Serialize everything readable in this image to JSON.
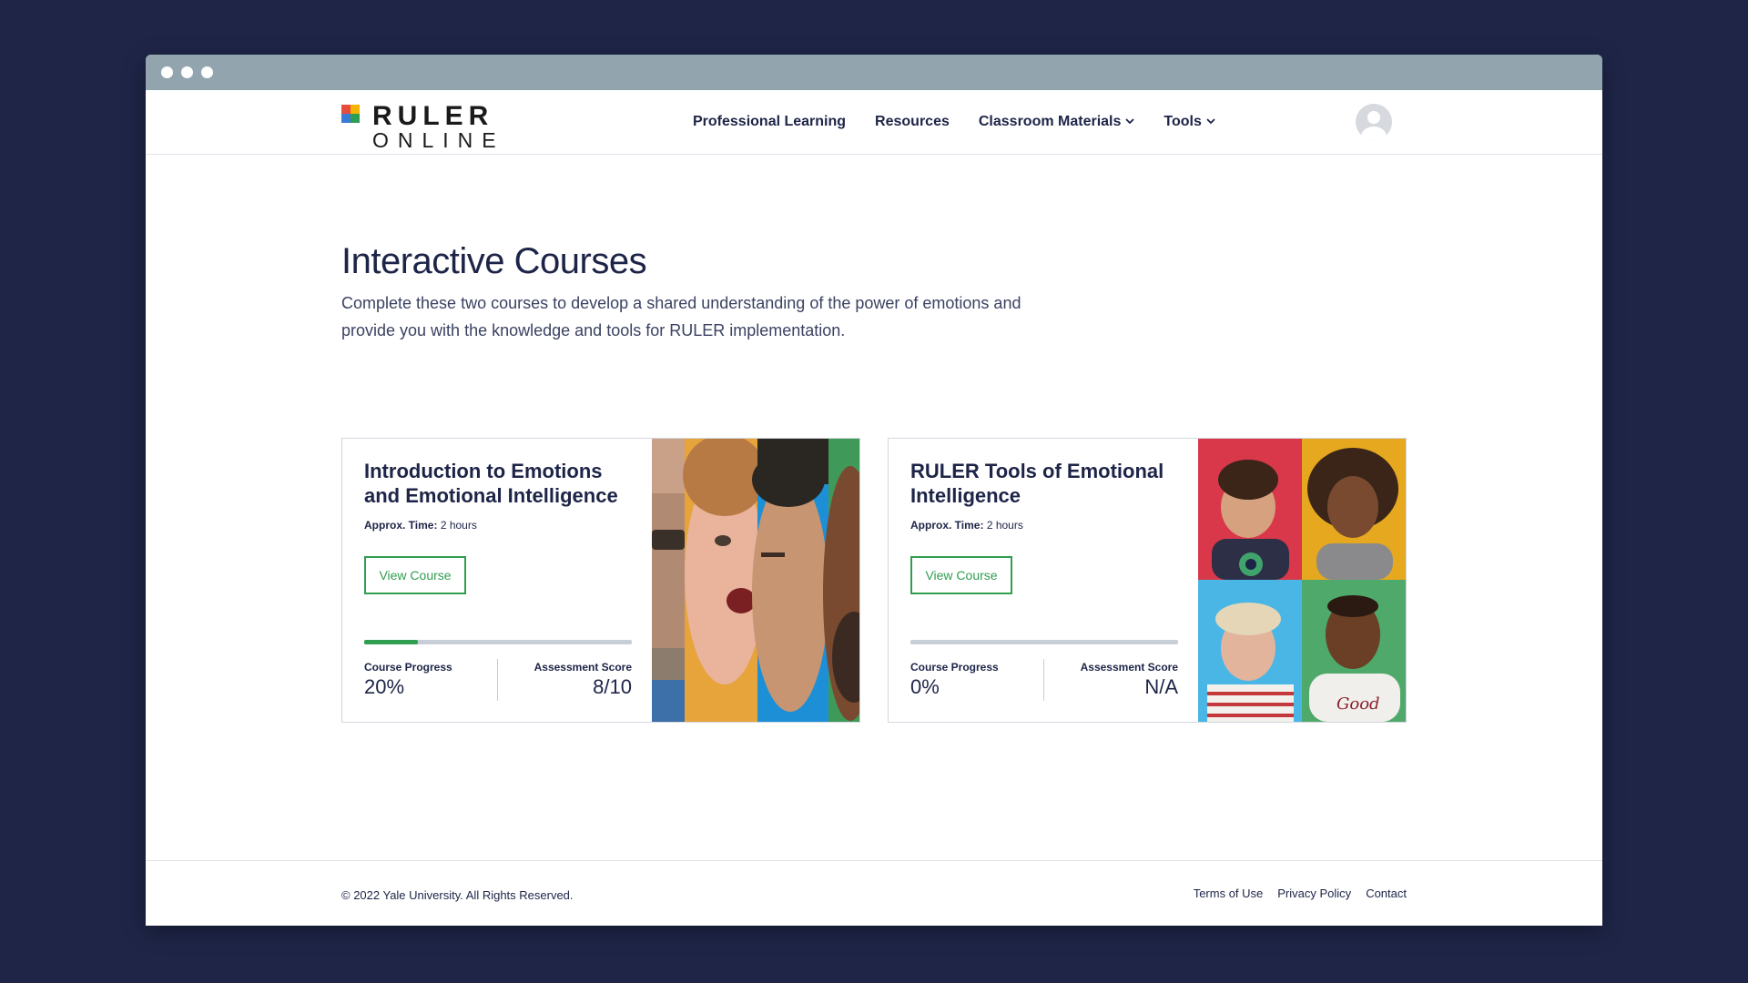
{
  "nav": {
    "logo_word_1": "RULER",
    "logo_word_2": "ONLINE",
    "logo_colors": [
      "#e84c3d",
      "#f4b400",
      "#3a7bd5",
      "#2e9e55"
    ],
    "links": [
      {
        "label": "Professional Learning",
        "has_dropdown": false
      },
      {
        "label": "Resources",
        "has_dropdown": false
      },
      {
        "label": "Classroom Materials",
        "has_dropdown": true
      },
      {
        "label": "Tools",
        "has_dropdown": true
      }
    ],
    "dropdown_icon": "chevron-down-icon",
    "avatar_icon": "user-avatar-icon"
  },
  "main": {
    "title": "Interactive Courses",
    "description": "Complete these two courses to develop a shared understanding of the power of emotions and provide you with the knowledge and tools for RULER implementation."
  },
  "courses": [
    {
      "title": "Introduction to Emotions and Emotional Intelligence",
      "time_label": "Approx. Time:",
      "time_value": "2 hours",
      "button_label": "View Course",
      "progress_label": "Course Progress",
      "progress_value": "20%",
      "progress_fraction": 0.2,
      "score_label": "Assessment Score",
      "score_value": "8/10"
    },
    {
      "title": "RULER Tools of Emotional Intelligence",
      "time_label": "Approx. Time:",
      "time_value": "2 hours",
      "button_label": "View Course",
      "progress_label": "Course Progress",
      "progress_value": "0%",
      "progress_fraction": 0,
      "score_label": "Assessment Score",
      "score_value": "N/A"
    }
  ],
  "footer": {
    "copyright": "© 2022 Yale University. All Rights Reserved.",
    "links": [
      "Terms of Use",
      "Privacy Policy",
      "Contact"
    ]
  },
  "colors": {
    "accent_green": "#2f9e50",
    "navy": "#1d2447",
    "page_background": "#1e2547",
    "titlebar": "#92a5ae"
  }
}
